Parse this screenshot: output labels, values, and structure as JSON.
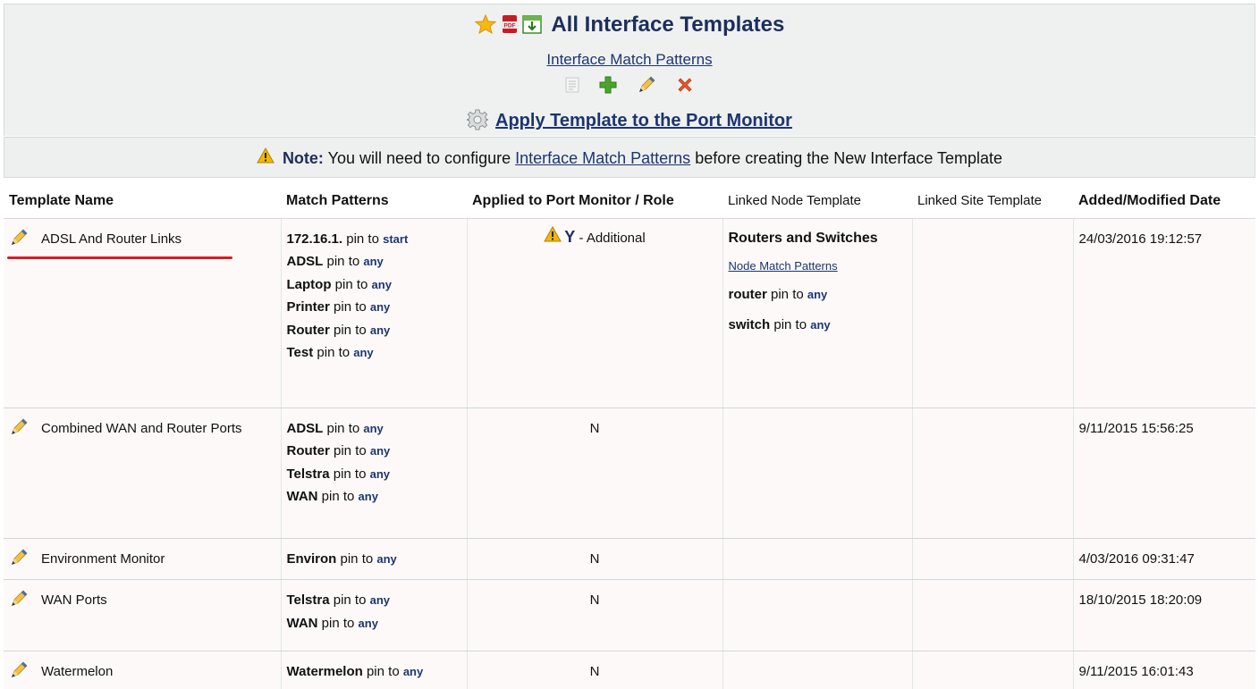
{
  "header": {
    "title": "All Interface Templates",
    "match_patterns_link": "Interface Match Patterns",
    "apply_link": "Apply Template to the Port Monitor",
    "icons": [
      "star-icon",
      "pdf-icon",
      "export-icon",
      "document-icon",
      "add-icon",
      "edit-icon",
      "delete-icon",
      "gear-icon"
    ]
  },
  "note": {
    "label": "Note:",
    "text_before": " You will need to configure ",
    "link": "Interface Match Patterns",
    "text_after": " before creating the New Interface Template"
  },
  "table": {
    "columns": [
      "Template Name",
      "Match Patterns",
      "Applied to Port Monitor / Role",
      "Linked Node Template",
      "Linked Site Template",
      "Added/Modified Date"
    ],
    "pin_to": " pin to ",
    "rows": [
      {
        "name": "ADSL And Router Links",
        "patterns": [
          {
            "word": "172.16.1.",
            "anchor": "start"
          },
          {
            "word": "ADSL",
            "anchor": "any"
          },
          {
            "word": "Laptop",
            "anchor": "any"
          },
          {
            "word": "Printer",
            "anchor": "any"
          },
          {
            "word": "Router",
            "anchor": "any"
          },
          {
            "word": "Test",
            "anchor": "any"
          }
        ],
        "applied": "Y",
        "role": " - Additional",
        "node_template": "Routers and Switches",
        "node_link": "Node Match Patterns",
        "node_patterns": [
          {
            "word": "router",
            "anchor": "any"
          },
          {
            "word": "switch",
            "anchor": "any"
          }
        ],
        "site_template": "",
        "date": "24/03/2016 19:12:57"
      },
      {
        "name": "Combined WAN and Router Ports",
        "patterns": [
          {
            "word": "ADSL",
            "anchor": "any"
          },
          {
            "word": "Router",
            "anchor": "any"
          },
          {
            "word": "Telstra",
            "anchor": "any"
          },
          {
            "word": "WAN",
            "anchor": "any"
          }
        ],
        "applied": "N",
        "date": "9/11/2015 15:56:25"
      },
      {
        "name": "Environment Monitor",
        "patterns": [
          {
            "word": "Environ",
            "anchor": "any"
          }
        ],
        "applied": "N",
        "date": "4/03/2016 09:31:47"
      },
      {
        "name": "WAN Ports",
        "patterns": [
          {
            "word": "Telstra",
            "anchor": "any"
          },
          {
            "word": "WAN",
            "anchor": "any"
          }
        ],
        "applied": "N",
        "date": "18/10/2015 18:20:09"
      },
      {
        "name": "Watermelon",
        "patterns": [
          {
            "word": "Watermelon",
            "anchor": "any"
          }
        ],
        "applied": "N",
        "date": "9/11/2015 16:01:43"
      }
    ]
  },
  "colors": {
    "header_bg": "#eff1f1",
    "row_bg": "#fdf9f9",
    "link": "#1c3570",
    "annotation_underline": "#d11f26"
  }
}
